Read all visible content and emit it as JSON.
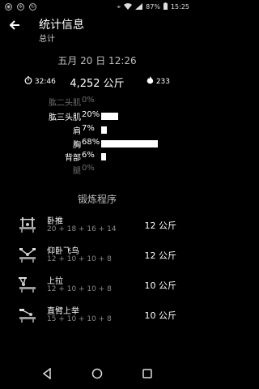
{
  "status": {
    "battery": "87%",
    "time": "15:25"
  },
  "header": {
    "title": "统计信息",
    "subtitle": "总计"
  },
  "date": "五月 20 日 12:26",
  "stats": {
    "duration": "32:46",
    "weight": "4,252 公斤",
    "calories": "233"
  },
  "muscles": [
    {
      "name": "肱二头肌",
      "percent": "0%",
      "value": 0,
      "active": false
    },
    {
      "name": "肱三头肌",
      "percent": "20%",
      "value": 20,
      "active": true
    },
    {
      "name": "肩",
      "percent": "7%",
      "value": 7,
      "active": true
    },
    {
      "name": "胸",
      "percent": "68%",
      "value": 68,
      "active": true
    },
    {
      "name": "背部",
      "percent": "6%",
      "value": 6,
      "active": true
    },
    {
      "name": "腿",
      "percent": "0%",
      "value": 0,
      "active": false
    }
  ],
  "section_title": "锻炼程序",
  "exercises": [
    {
      "name": "卧推",
      "sets": "20 + 18 + 16 + 14",
      "weight": "12 公斤",
      "icon": "bench-press-icon"
    },
    {
      "name": "仰卧飞鸟",
      "sets": "12 + 10 + 10 + 8",
      "weight": "12 公斤",
      "icon": "dumbbell-fly-icon"
    },
    {
      "name": "上拉",
      "sets": "12 + 10 + 10 + 8",
      "weight": "10 公斤",
      "icon": "pull-up-icon"
    },
    {
      "name": "直臂上举",
      "sets": "15 + 10 + 10 + 8",
      "weight": "10 公斤",
      "icon": "straight-arm-raise-icon"
    }
  ]
}
